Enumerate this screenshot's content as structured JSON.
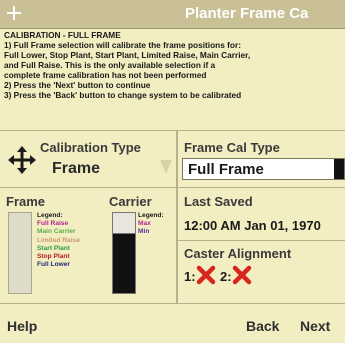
{
  "header": {
    "title": "Planter Frame Ca"
  },
  "instructions": {
    "lines": [
      "CALIBRATION - FULL FRAME",
      "1) Full Frame selection will calibrate the frame positions for:",
      "Full Lower, Stop Plant, Start Plant, Limited Raise, Main Carrier,",
      "and Full Raise.  This is the only available selection if a",
      "complete frame calibration has not been performed",
      "2) Press the 'Next' button to continue",
      "3) Press the 'Back' button to change system to be calibrated"
    ]
  },
  "calibration_type": {
    "label": "Calibration Type",
    "value": "Frame"
  },
  "frame_cal_type": {
    "label": "Frame Cal Type",
    "value": "Full Frame"
  },
  "frame": {
    "label": "Frame",
    "legend_title": "Legend:",
    "legend_items": [
      {
        "label": "Full Raise",
        "color": "#b4238f"
      },
      {
        "label": "Main Carrier",
        "color": "#58b04a"
      },
      {
        "label": "Limited Raise",
        "color": "#c89a6b"
      },
      {
        "label": "Start Plant",
        "color": "#2f9e3b"
      },
      {
        "label": "Stop Plant",
        "color": "#b51c1c"
      },
      {
        "label": "Full Lower",
        "color": "#1f2c7a"
      }
    ]
  },
  "carrier": {
    "label": "Carrier",
    "legend_title": "Legend:",
    "legend_items": [
      {
        "label": "Max",
        "color": "#b4238f"
      },
      {
        "label": "Min",
        "color": "#5b2fa0"
      }
    ]
  },
  "last_saved": {
    "label": "Last Saved",
    "value": "12:00 AM Jan 01, 1970"
  },
  "caster_alignment": {
    "label": "Caster Alignment",
    "item1": "1:",
    "item2": "2:"
  },
  "buttons": {
    "help": "Help",
    "back": "Back",
    "next": "Next"
  },
  "colors": {
    "background": "#f3edc2",
    "header": "#c9c095",
    "error_x": "#d7261e"
  }
}
